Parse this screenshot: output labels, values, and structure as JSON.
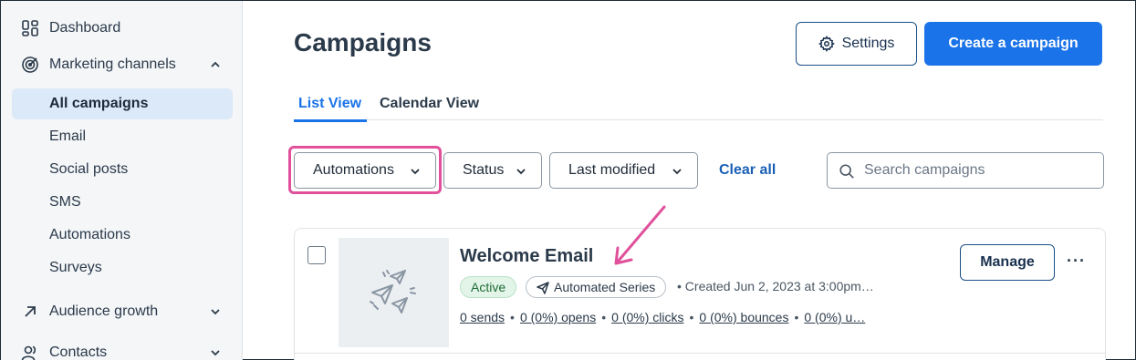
{
  "sidebar": {
    "items": [
      {
        "label": "Dashboard",
        "icon": "dashboard-icon"
      },
      {
        "label": "Marketing channels",
        "icon": "target-icon",
        "expanded": true
      },
      {
        "label": "All campaigns",
        "active": true
      },
      {
        "label": "Email"
      },
      {
        "label": "Social posts"
      },
      {
        "label": "SMS"
      },
      {
        "label": "Automations"
      },
      {
        "label": "Surveys"
      },
      {
        "label": "Audience growth",
        "icon": "arrow-up-right-icon"
      },
      {
        "label": "Contacts",
        "icon": "contacts-icon"
      }
    ]
  },
  "header": {
    "title": "Campaigns",
    "settings_label": "Settings",
    "create_label": "Create a campaign"
  },
  "tabs": [
    {
      "label": "List View",
      "active": true
    },
    {
      "label": "Calendar View"
    }
  ],
  "filters": {
    "items": [
      "Automations",
      "Status",
      "Last modified"
    ],
    "clear_all": "Clear all",
    "search_placeholder": "Search campaigns",
    "search_value": ""
  },
  "campaign": {
    "title": "Welcome Email",
    "status": "Active",
    "type": "Automated Series",
    "created": "• Created Jun 2, 2023 at 3:00pm…",
    "stats": [
      "0 sends",
      "0 (0%) opens",
      "0 (0%) clicks",
      "0 (0%) bounces",
      "0 (0%) u…"
    ],
    "manage_label": "Manage",
    "more_label": "···"
  },
  "colors": {
    "primary": "#1a73e8",
    "highlight": "#e0509b",
    "active_nav_bg": "#dce9f8",
    "success": "#1d6b35"
  }
}
